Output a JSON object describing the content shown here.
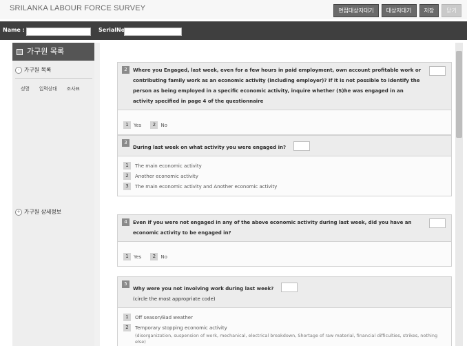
{
  "app": {
    "title": "SRILANKA LABOUR FORCE SURVEY",
    "buttons": [
      "면접대상자대기",
      "대상자대기",
      "저장",
      "닫기"
    ]
  },
  "info": {
    "name_label": "Name :",
    "serial_label": "SerialNo :"
  },
  "sidebar": {
    "header": "가구원 목록",
    "list_section": "가구원 목록",
    "columns": [
      "성명",
      "입력상태",
      "조사표"
    ],
    "detail_section": "가구원 상세정보"
  },
  "questions": [
    {
      "num": "2",
      "text": "Where you Engaged, last week, even for a few hours in paid employment, own account profitable work or contributing family work as an economic activity (including employer)? If it is not possible to identify the person as being employed in a specific economic activity, inquire whether (S)he was engaged in an activity specified in page 4 of the questionnaire",
      "options": [
        {
          "code": "1",
          "label": "Yes"
        },
        {
          "code": "2",
          "label": "No"
        }
      ]
    },
    {
      "num": "3",
      "text": "During last week on what activity you were engaged in?",
      "options": [
        {
          "code": "1",
          "label": "The main economic activity"
        },
        {
          "code": "2",
          "label": "Another economic activity"
        },
        {
          "code": "3",
          "label": "The main economic activity and Another economic activity"
        }
      ]
    },
    {
      "num": "4",
      "text": "Even if you were not engaged in any of the above economic activity during last week, did you have an economic activity to be engaged in?",
      "options": [
        {
          "code": "1",
          "label": "Yes"
        },
        {
          "code": "2",
          "label": "No"
        }
      ]
    },
    {
      "num": "5",
      "text": "Why were you not involving work during last week?",
      "subtitle": "(circle the most appropriate code)",
      "options": [
        {
          "code": "1",
          "label": "Off season/Bad weather"
        },
        {
          "code": "2",
          "label": "Temporary stopping economic activity",
          "detail": "(disorganization, suspension of work, mechanical, electrical breakdown, Shortage of raw material, financial difficulties, strikes, nothing else)"
        }
      ]
    }
  ]
}
